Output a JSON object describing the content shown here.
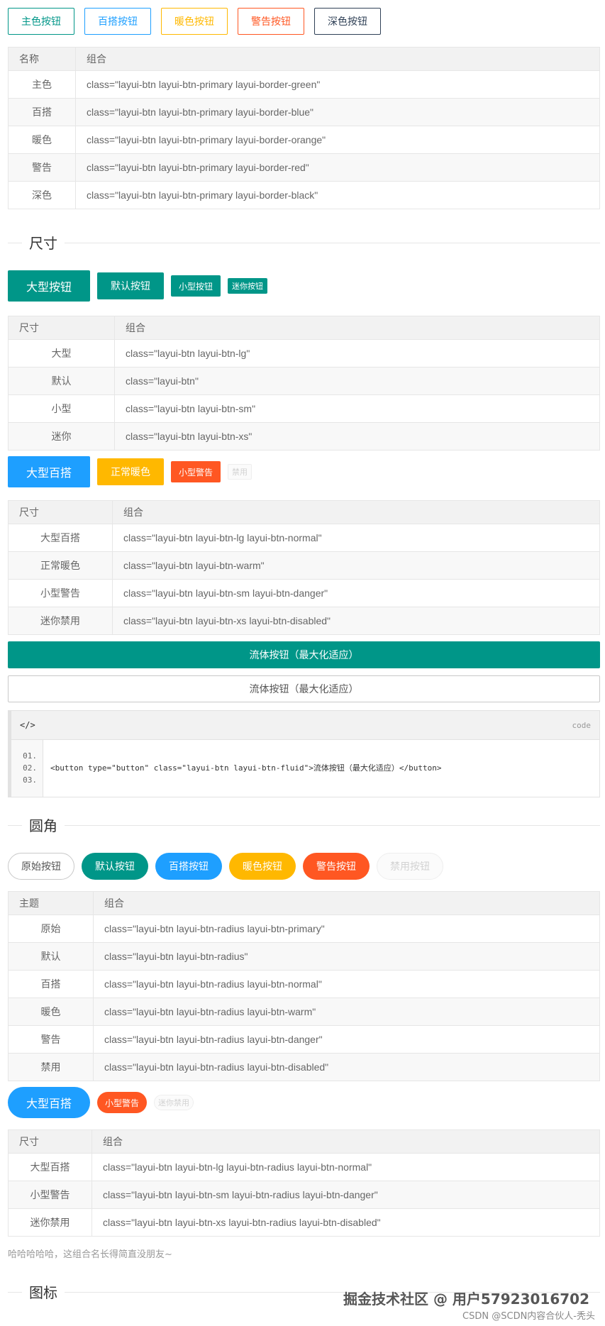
{
  "border_buttons": [
    "主色按钮",
    "百搭按钮",
    "暖色按钮",
    "警告按钮",
    "深色按钮"
  ],
  "border_table": {
    "headers": [
      "名称",
      "组合"
    ],
    "rows": [
      [
        "主色",
        "class=\"layui-btn layui-btn-primary layui-border-green\""
      ],
      [
        "百搭",
        "class=\"layui-btn layui-btn-primary layui-border-blue\""
      ],
      [
        "暖色",
        "class=\"layui-btn layui-btn-primary layui-border-orange\""
      ],
      [
        "警告",
        "class=\"layui-btn layui-btn-primary layui-border-red\""
      ],
      [
        "深色",
        "class=\"layui-btn layui-btn-primary layui-border-black\""
      ]
    ]
  },
  "size_section": {
    "title": "尺寸",
    "buttons": [
      "大型按钮",
      "默认按钮",
      "小型按钮",
      "迷你按钮"
    ],
    "table": {
      "headers": [
        "尺寸",
        "组合"
      ],
      "rows": [
        [
          "大型",
          "class=\"layui-btn layui-btn-lg\""
        ],
        [
          "默认",
          "class=\"layui-btn\""
        ],
        [
          "小型",
          "class=\"layui-btn layui-btn-sm\""
        ],
        [
          "迷你",
          "class=\"layui-btn layui-btn-xs\""
        ]
      ]
    },
    "buttons2": [
      "大型百搭",
      "正常暖色",
      "小型警告",
      "禁用"
    ],
    "table2": {
      "headers": [
        "尺寸",
        "组合"
      ],
      "rows": [
        [
          "大型百搭",
          "class=\"layui-btn layui-btn-lg layui-btn-normal\""
        ],
        [
          "正常暖色",
          "class=\"layui-btn layui-btn-warm\""
        ],
        [
          "小型警告",
          "class=\"layui-btn layui-btn-sm layui-btn-danger\""
        ],
        [
          "迷你禁用",
          "class=\"layui-btn layui-btn-xs layui-btn-disabled\""
        ]
      ]
    },
    "fluid_label": "流体按钮（最大化适应）",
    "fluid_label2": "流体按钮（最大化适应）",
    "code": {
      "header_icon": "</>",
      "tag": "code",
      "line_numbers": [
        "01.",
        "02.",
        "03."
      ],
      "source": "<button type=\"button\" class=\"layui-btn layui-btn-fluid\">流体按钮（最大化适应）</button>"
    }
  },
  "radius_section": {
    "title": "圆角",
    "buttons": [
      "原始按钮",
      "默认按钮",
      "百搭按钮",
      "暖色按钮",
      "警告按钮",
      "禁用按钮"
    ],
    "table": {
      "headers": [
        "主题",
        "组合"
      ],
      "rows": [
        [
          "原始",
          "class=\"layui-btn layui-btn-radius layui-btn-primary\""
        ],
        [
          "默认",
          "class=\"layui-btn layui-btn-radius\""
        ],
        [
          "百搭",
          "class=\"layui-btn layui-btn-radius layui-btn-normal\""
        ],
        [
          "暖色",
          "class=\"layui-btn layui-btn-radius layui-btn-warm\""
        ],
        [
          "警告",
          "class=\"layui-btn layui-btn-radius layui-btn-danger\""
        ],
        [
          "禁用",
          "class=\"layui-btn layui-btn-radius layui-btn-disabled\""
        ]
      ]
    },
    "buttons2": [
      "大型百搭",
      "小型警告",
      "迷你禁用"
    ],
    "table2": {
      "headers": [
        "尺寸",
        "组合"
      ],
      "rows": [
        [
          "大型百搭",
          "class=\"layui-btn layui-btn-lg layui-btn-radius layui-btn-normal\""
        ],
        [
          "小型警告",
          "class=\"layui-btn layui-btn-sm layui-btn-radius layui-btn-danger\""
        ],
        [
          "迷你禁用",
          "class=\"layui-btn layui-btn-xs layui-btn-radius layui-btn-disabled\""
        ]
      ]
    },
    "note": "哈哈哈哈哈，这组合名长得简直没朋友~"
  },
  "icon_section": {
    "title": "图标"
  },
  "watermark": {
    "main": "掘金技术社区 @ 用户57923016702",
    "sub": "CSDN @SCDN内容合伙人-秃头"
  },
  "colors": {
    "green": "#009688",
    "blue": "#1e9fff",
    "orange": "#ffb800",
    "red": "#ff5722",
    "black": "#2f4056"
  }
}
